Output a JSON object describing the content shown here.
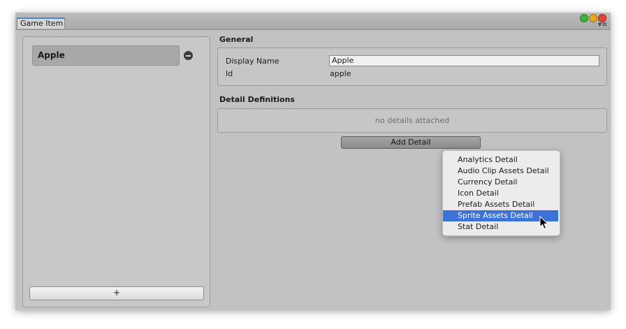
{
  "window": {
    "tab_label": "Game Item",
    "menu_icon": "▾≡"
  },
  "list": {
    "items": [
      {
        "label": "Apple"
      }
    ],
    "add_button_label": "+"
  },
  "general": {
    "title": "General",
    "display_name_label": "Display Name",
    "display_name_value": "Apple",
    "id_label": "Id",
    "id_value": "apple"
  },
  "details": {
    "title": "Detail Definitions",
    "empty_message": "no details attached",
    "add_button_label": "Add Detail"
  },
  "dropdown": {
    "items": [
      "Analytics Detail",
      "Audio Clip Assets Detail",
      "Currency Detail",
      "Icon Detail",
      "Prefab Assets Detail",
      "Sprite Assets Detail",
      "Stat Detail"
    ],
    "selected": "Sprite Assets Detail"
  },
  "colors": {
    "selection": "#3d73d8",
    "panel": "#c2c2c2"
  }
}
